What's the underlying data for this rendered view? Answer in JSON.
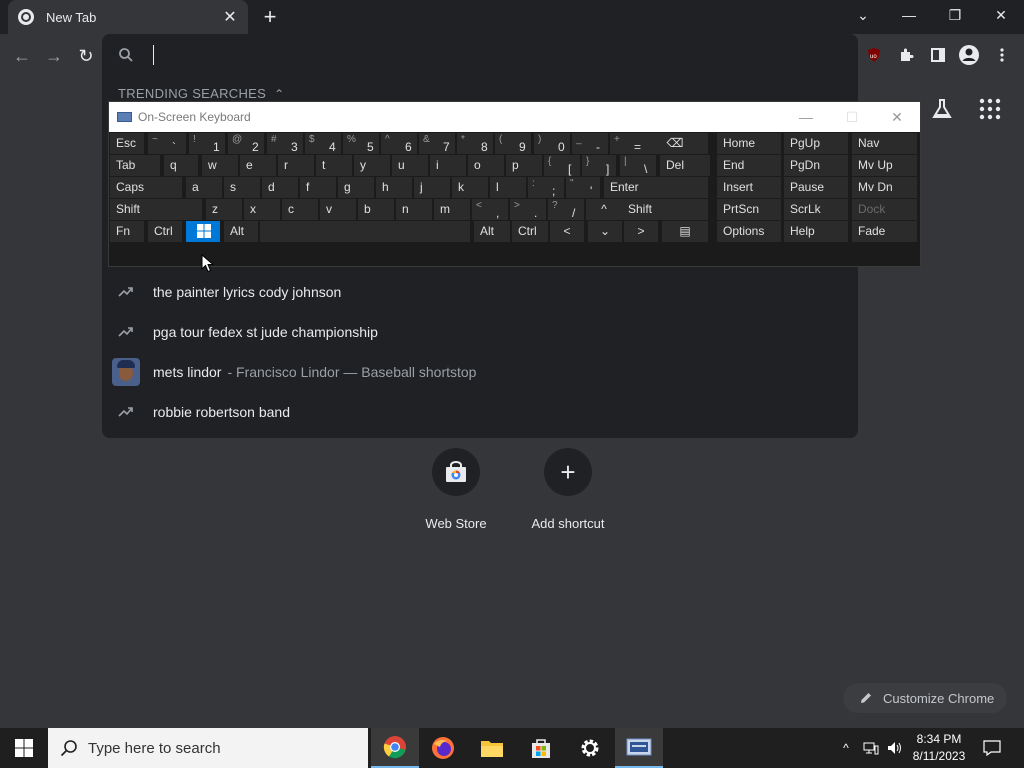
{
  "browser": {
    "tab_title": "New Tab",
    "tab_close": "✕",
    "new_tab": "+",
    "window_controls": {
      "dropdown": "⌄",
      "minimize": "—",
      "restore": "❐",
      "close": "✕"
    },
    "nav": {
      "back": "←",
      "forward": "→",
      "reload": "↻"
    },
    "omnibox_value": "",
    "extensions": [
      "ublock-icon",
      "puzzle-icon",
      "sidepanel-icon",
      "profile-icon",
      "menu-icon"
    ]
  },
  "dropdown": {
    "header": "TRENDING SEARCHES",
    "header_chevron": "⌃",
    "suggestions": [
      {
        "text": "the painter lyrics cody johnson",
        "desc": ""
      },
      {
        "text": "pga tour fedex st jude championship",
        "desc": ""
      },
      {
        "text": "mets lindor",
        "desc": "- Francisco Lindor — Baseball shortstop"
      },
      {
        "text": "robbie robertson band",
        "desc": ""
      }
    ]
  },
  "osk": {
    "title": "On-Screen Keyboard",
    "title_controls": {
      "minimize": "—",
      "maximize": "☐",
      "close": "✕"
    },
    "rows": [
      [
        {
          "l": "Esc"
        },
        {
          "t": "~",
          "m": "`"
        },
        {
          "t": "!",
          "m": "1"
        },
        {
          "t": "@",
          "m": "2"
        },
        {
          "t": "#",
          "m": "3"
        },
        {
          "t": "$",
          "m": "4"
        },
        {
          "t": "%",
          "m": "5"
        },
        {
          "t": "^",
          "m": "6"
        },
        {
          "t": "&",
          "m": "7"
        },
        {
          "t": "*",
          "m": "8"
        },
        {
          "t": "(",
          "m": "9"
        },
        {
          "t": ")",
          "m": "0"
        },
        {
          "t": "_",
          "m": "-"
        },
        {
          "t": "+",
          "m": "="
        },
        {
          "l": "⌫"
        },
        {
          "l": "Home"
        },
        {
          "l": "PgUp"
        },
        {
          "l": "Nav"
        }
      ],
      [
        {
          "l": "Tab"
        },
        {
          "l": "q"
        },
        {
          "l": "w"
        },
        {
          "l": "e"
        },
        {
          "l": "r"
        },
        {
          "l": "t"
        },
        {
          "l": "y"
        },
        {
          "l": "u"
        },
        {
          "l": "i"
        },
        {
          "l": "o"
        },
        {
          "l": "p"
        },
        {
          "t": "{",
          "m": "["
        },
        {
          "t": "}",
          "m": "]"
        },
        {
          "t": "|",
          "m": "\\"
        },
        {
          "l": "Del"
        },
        {
          "l": "End"
        },
        {
          "l": "PgDn"
        },
        {
          "l": "Mv Up"
        }
      ],
      [
        {
          "l": "Caps"
        },
        {
          "l": "a"
        },
        {
          "l": "s"
        },
        {
          "l": "d"
        },
        {
          "l": "f"
        },
        {
          "l": "g"
        },
        {
          "l": "h"
        },
        {
          "l": "j"
        },
        {
          "l": "k"
        },
        {
          "l": "l"
        },
        {
          "t": ":",
          "m": ";"
        },
        {
          "t": "\"",
          "m": "'"
        },
        {
          "l": "Enter"
        },
        {
          "l": "Insert"
        },
        {
          "l": "Pause"
        },
        {
          "l": "Mv Dn"
        }
      ],
      [
        {
          "l": "Shift"
        },
        {
          "l": "z"
        },
        {
          "l": "x"
        },
        {
          "l": "c"
        },
        {
          "l": "v"
        },
        {
          "l": "b"
        },
        {
          "l": "n"
        },
        {
          "l": "m"
        },
        {
          "t": "<",
          "m": ","
        },
        {
          "t": ">",
          "m": "."
        },
        {
          "t": "?",
          "m": "/"
        },
        {
          "l": "^"
        },
        {
          "l": "Shift"
        },
        {
          "l": "PrtScn"
        },
        {
          "l": "ScrLk"
        },
        {
          "l": "Dock"
        }
      ],
      [
        {
          "l": "Fn"
        },
        {
          "l": "Ctrl"
        },
        {
          "l": "win"
        },
        {
          "l": "Alt"
        },
        {
          "l": ""
        },
        {
          "l": "Alt"
        },
        {
          "l": "Ctrl"
        },
        {
          "l": "<"
        },
        {
          "l": "⌄"
        },
        {
          "l": ">"
        },
        {
          "l": "▤"
        },
        {
          "l": "Options"
        },
        {
          "l": "Help"
        },
        {
          "l": "Fade"
        }
      ]
    ]
  },
  "shortcuts": [
    {
      "label": "Web Store",
      "icon": "webstore-icon"
    },
    {
      "label": "Add shortcut",
      "icon": "plus-icon",
      "glyph": "+"
    }
  ],
  "customize_label": "Customize Chrome",
  "taskbar": {
    "search_placeholder": "Type here to search",
    "apps": [
      "chrome-icon",
      "firefox-icon",
      "file-explorer-icon",
      "microsoft-store-icon",
      "settings-icon",
      "osk-app-icon"
    ],
    "time": "8:34 PM",
    "date": "8/11/2023",
    "tray_chevron": "^"
  }
}
